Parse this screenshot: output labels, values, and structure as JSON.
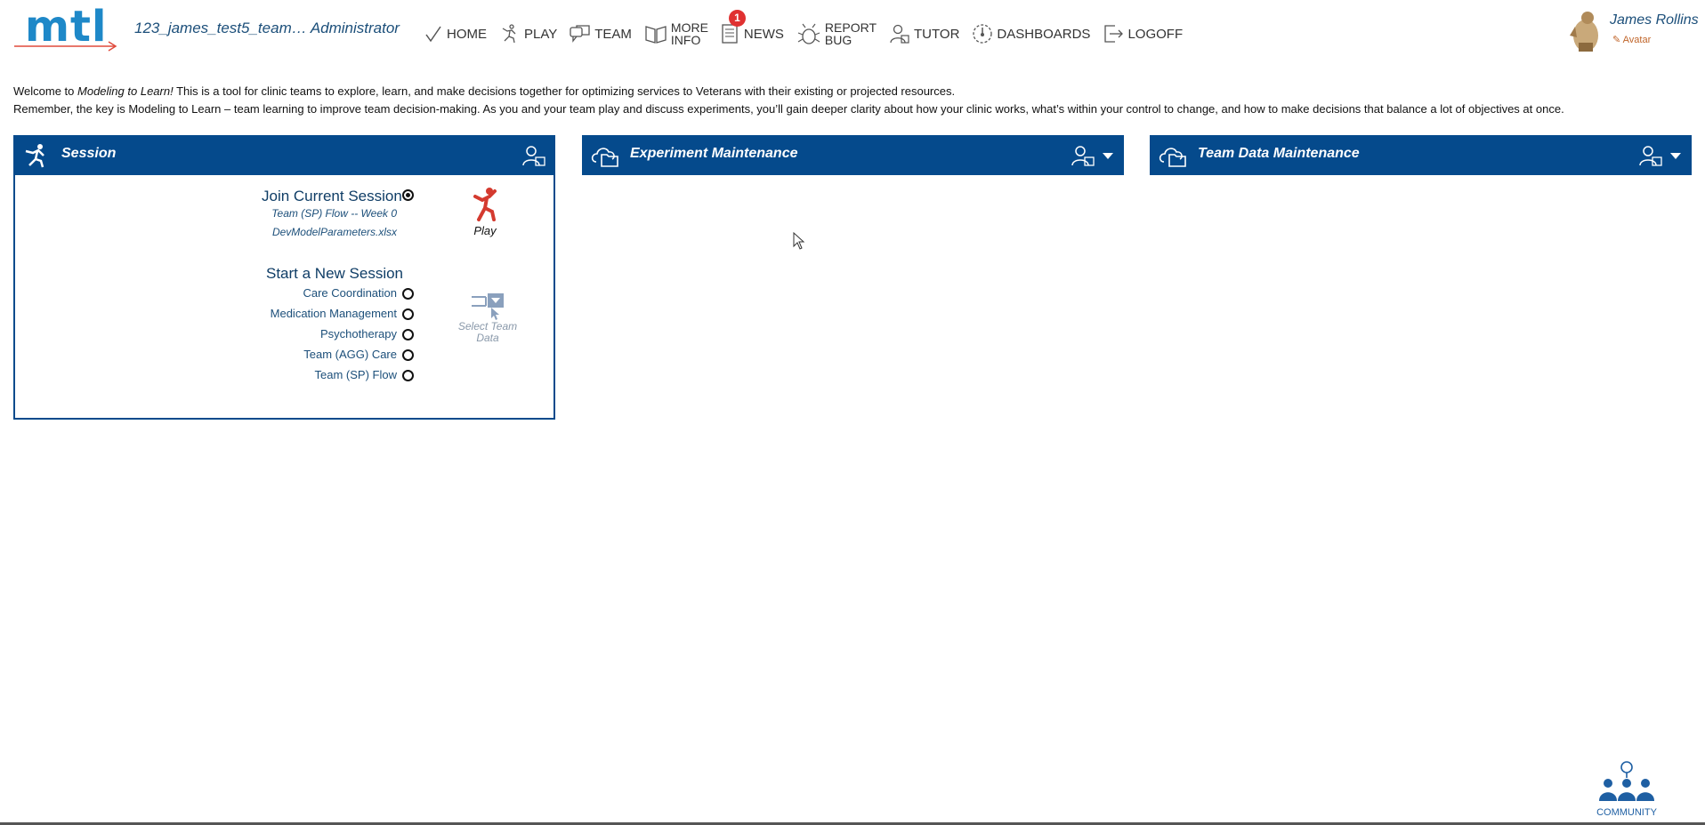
{
  "header": {
    "logo_text": "mtl",
    "team_title": "123_james_test5_team… Administrator",
    "nav": {
      "home": "HOME",
      "play": "PLAY",
      "team": "TEAM",
      "more_line1": "MORE",
      "more_line2": "INFO",
      "news": "NEWS",
      "news_badge": "1",
      "report_line1": "REPORT",
      "report_line2": "BUG",
      "tutor": "TUTOR",
      "dashboards": "DASHBOARDS",
      "logoff": "LOGOFF"
    },
    "user": {
      "name": "James Rollins",
      "edit_label": "Avatar"
    }
  },
  "intro": {
    "line1_prefix": "Welcome to ",
    "line1_em": "Modeling to Learn!",
    "line1_rest": " This is a tool for clinic teams to explore, learn, and make decisions together for optimizing services to Veterans with their existing or projected resources.",
    "line2": "Remember, the key is Modeling to Learn – team learning to improve team decision-making. As you and your team play and discuss experiments, you’ll gain deeper clarity about how your clinic works, what’s within your control to change, and how to make decisions that balance a lot of objectives at once."
  },
  "panels": {
    "session": "Session",
    "experiment": "Experiment Maintenance",
    "teamdata": "Team Data Maintenance"
  },
  "session": {
    "join_title": "Join Current Session",
    "join_line1": "Team (SP) Flow -- Week 0",
    "join_line2": "DevModelParameters.xlsx",
    "play_label": "Play",
    "start_title": "Start a New Session",
    "options": [
      "Care Coordination",
      "Medication Management",
      "Psychotherapy",
      "Team (AGG) Care",
      "Team (SP) Flow"
    ],
    "select_label_line1": "Select Team",
    "select_label_line2": "Data"
  },
  "footer": {
    "community": "COMMUNITY"
  },
  "colors": {
    "brand_blue": "#054a8c",
    "logo_blue": "#1e88c8",
    "accent_red": "#e03131"
  }
}
